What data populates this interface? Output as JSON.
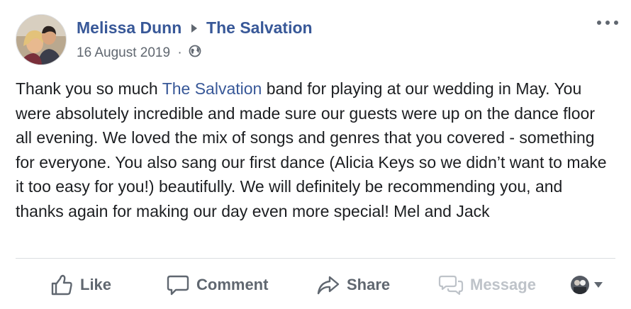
{
  "post": {
    "author": "Melissa Dunn",
    "target_page": "The Salvation",
    "date": "16 August 2019",
    "meta_separator": "·",
    "privacy_icon": "globe-icon",
    "body": {
      "part1": "Thank you so much ",
      "mention": "The Salvation",
      "part2": " band for playing at our wedding in May. You were absolutely incredible and made sure our guests were up on the dance floor all evening. We loved the mix of songs and genres that you covered - something for everyone. You also sang our first dance (Alicia Keys so we didn’t want to make it too easy for you!) beautifully. We will definitely be recommending you, and thanks again for making our day even more special! Mel and Jack"
    }
  },
  "actions": {
    "like": "Like",
    "comment": "Comment",
    "share": "Share",
    "message": "Message"
  },
  "colors": {
    "link": "#385898",
    "text": "#1c1e21",
    "muted": "#606770",
    "disabled": "#bec3c9",
    "divider": "#dadde1"
  }
}
